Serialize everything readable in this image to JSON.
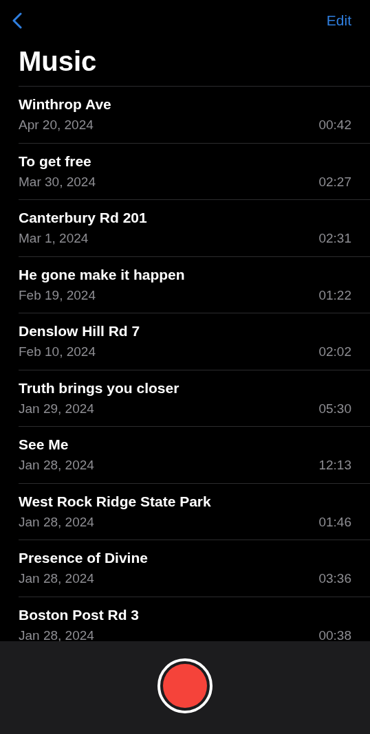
{
  "nav": {
    "edit_label": "Edit"
  },
  "title": "Music",
  "recordings": [
    {
      "name": "Winthrop Ave",
      "date": "Apr 20, 2024",
      "duration": "00:42"
    },
    {
      "name": "To get free",
      "date": "Mar 30, 2024",
      "duration": "02:27"
    },
    {
      "name": "Canterbury Rd 201",
      "date": "Mar 1, 2024",
      "duration": "02:31"
    },
    {
      "name": "He gone make it happen",
      "date": "Feb 19, 2024",
      "duration": "01:22"
    },
    {
      "name": "Denslow Hill Rd 7",
      "date": "Feb 10, 2024",
      "duration": "02:02"
    },
    {
      "name": "Truth brings you closer",
      "date": "Jan 29, 2024",
      "duration": "05:30"
    },
    {
      "name": "See Me",
      "date": "Jan 28, 2024",
      "duration": "12:13"
    },
    {
      "name": "West Rock Ridge State Park",
      "date": "Jan 28, 2024",
      "duration": "01:46"
    },
    {
      "name": "Presence of Divine",
      "date": "Jan 28, 2024",
      "duration": "03:36"
    },
    {
      "name": "Boston Post Rd 3",
      "date": "Jan 28, 2024",
      "duration": "00:38"
    }
  ],
  "record_button": {
    "recording": false
  }
}
